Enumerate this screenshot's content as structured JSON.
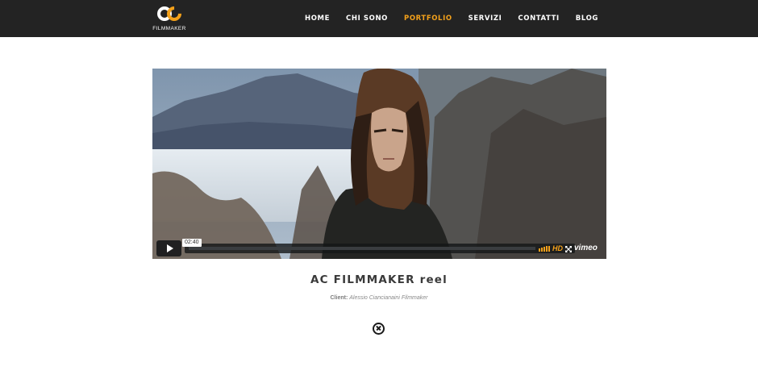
{
  "header": {
    "logo_text": "FILMMAKER",
    "logo_letters": "AC",
    "brand_accent": "#f4a11a",
    "background": "#232323",
    "nav": [
      {
        "label": "HOME",
        "active": false
      },
      {
        "label": "CHI SONO",
        "active": false
      },
      {
        "label": "PORTFOLIO",
        "active": true
      },
      {
        "label": "SERVIZI",
        "active": false
      },
      {
        "label": "CONTATTI",
        "active": false
      },
      {
        "label": "BLOG",
        "active": false
      }
    ]
  },
  "video": {
    "time": "02:40",
    "progress": 0,
    "hd_label": "HD",
    "vimeo_label": "vimeo",
    "icons": [
      "play-icon",
      "volume-icon",
      "fullscreen-icon"
    ]
  },
  "project": {
    "title": "AC FILMMAKER reel",
    "client_label": "Client:",
    "client_value": "Alessio Ciancianaini Filmmaker",
    "close_icon": "close-circle-icon"
  }
}
